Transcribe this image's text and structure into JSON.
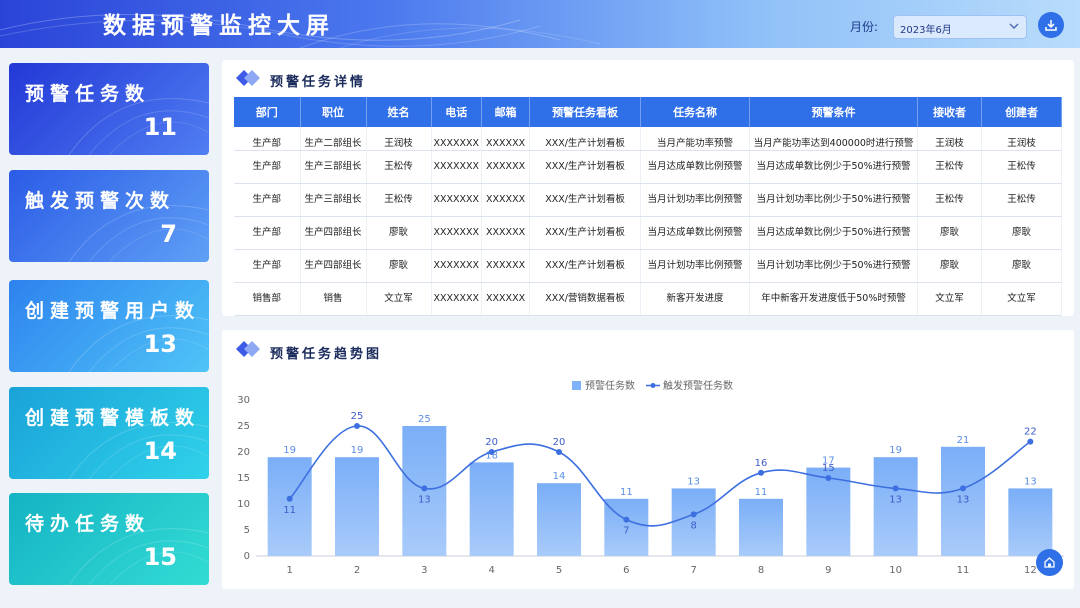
{
  "header": {
    "title": "数据预警监控大屏",
    "month_label": "月份:",
    "month_value": "2023年6月"
  },
  "cards": [
    {
      "label": "预警任务数",
      "value": "11",
      "from": "#2338d6",
      "to": "#4f7ef2"
    },
    {
      "label": "触发预警次数",
      "value": "7",
      "from": "#2b5be6",
      "to": "#5fa0f6"
    },
    {
      "label": "创建预警用户数",
      "value": "13",
      "from": "#2e82ee",
      "to": "#4fc4f7"
    },
    {
      "label": "创建预警模板数",
      "value": "14",
      "from": "#1aa2d8",
      "to": "#30d2ea"
    },
    {
      "label": "待办任务数",
      "value": "15",
      "from": "#14b3c4",
      "to": "#33dcd4"
    }
  ],
  "table_panel": {
    "title": "预警任务详情",
    "headers": [
      "部门",
      "职位",
      "姓名",
      "电话",
      "邮箱",
      "预警任务看板",
      "任务名称",
      "预警条件",
      "接收者",
      "创建者"
    ],
    "rows": [
      [
        "生产部",
        "生产二部组长",
        "王润枝",
        "XXXXXXX",
        "XXXXXX",
        "XXX/生产计划看板",
        "当月产能功率预警",
        "当月产能功率达到400000时进行预警",
        "王润枝",
        "王润枝"
      ],
      [
        "生产部",
        "生产三部组长",
        "王松传",
        "XXXXXXX",
        "XXXXXX",
        "XXX/生产计划看板",
        "当月达成单数比例预警",
        "当月达成单数比例少于50%进行预警",
        "王松传",
        "王松传"
      ],
      [
        "生产部",
        "生产三部组长",
        "王松传",
        "XXXXXXX",
        "XXXXXX",
        "XXX/生产计划看板",
        "当月计划功率比例预警",
        "当月计划功率比例少于50%进行预警",
        "王松传",
        "王松传"
      ],
      [
        "生产部",
        "生产四部组长",
        "廖耿",
        "XXXXXXX",
        "XXXXXX",
        "XXX/生产计划看板",
        "当月达成单数比例预警",
        "当月达成单数比例少于50%进行预警",
        "廖耿",
        "廖耿"
      ],
      [
        "生产部",
        "生产四部组长",
        "廖耿",
        "XXXXXXX",
        "XXXXXX",
        "XXX/生产计划看板",
        "当月计划功率比例预警",
        "当月计划功率比例少于50%进行预警",
        "廖耿",
        "廖耿"
      ],
      [
        "销售部",
        "销售",
        "文立军",
        "XXXXXXX",
        "XXXXXX",
        "XXX/营销数据看板",
        "新客开发进度",
        "年中新客开发进度低于50%时预警",
        "文立军",
        "文立军"
      ]
    ]
  },
  "chart_panel": {
    "title": "预警任务趋势图"
  },
  "chart_data": {
    "type": "bar",
    "categories": [
      "1",
      "2",
      "3",
      "4",
      "5",
      "6",
      "7",
      "8",
      "9",
      "10",
      "11",
      "12"
    ],
    "series": [
      {
        "name": "预警任务数",
        "type": "bar",
        "color": "#7fb2f8",
        "values": [
          19,
          19,
          25,
          18,
          14,
          11,
          13,
          11,
          17,
          19,
          21,
          13
        ]
      },
      {
        "name": "触发预警任务数",
        "type": "line",
        "color": "#3d6fe0",
        "values": [
          11,
          25,
          13,
          20,
          20,
          7,
          8,
          16,
          15,
          13,
          13,
          22
        ]
      }
    ],
    "ylim": [
      0,
      30
    ],
    "yticks": [
      0,
      5,
      10,
      15,
      20,
      25,
      30
    ],
    "legend": "top-center",
    "grid": false
  },
  "colors": {
    "accent": "#2f6fe8",
    "title_text": "#1a2b5c"
  },
  "icons": {
    "download": "download-icon",
    "month_dropdown": "chevron-down-icon",
    "float": "home-icon"
  }
}
